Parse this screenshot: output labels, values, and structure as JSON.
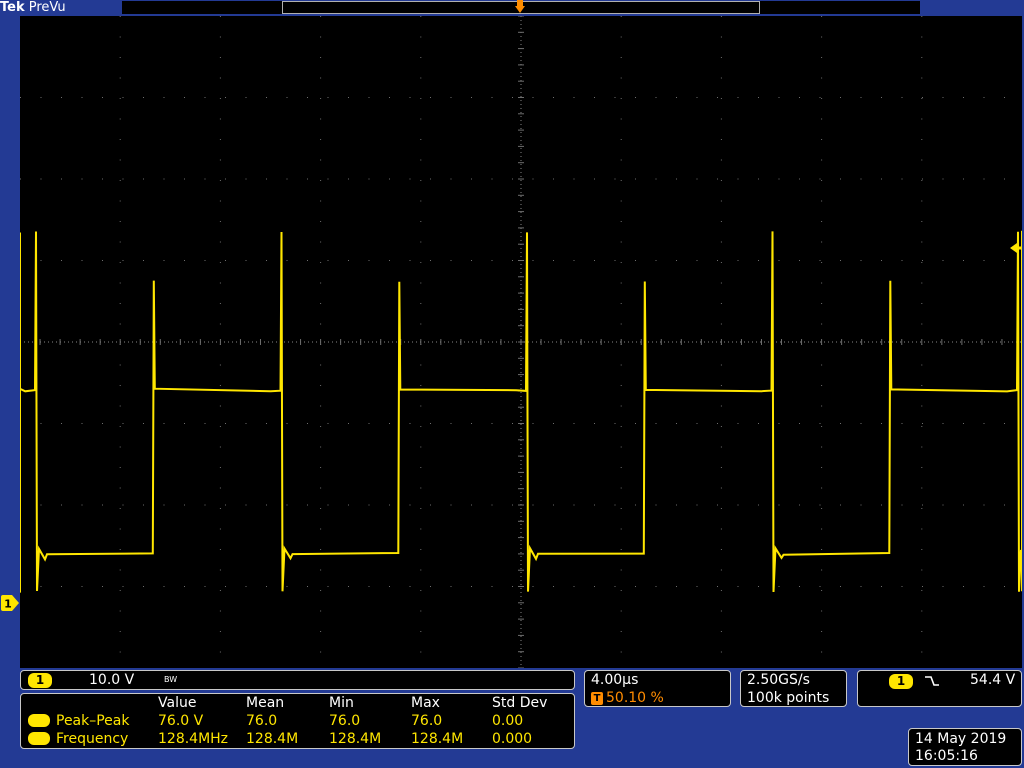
{
  "app": {
    "brand": "Tek",
    "mode": "PreVu"
  },
  "colors": {
    "background": "#233a94",
    "graticule_bg": "#000000",
    "trace": "#ffe600",
    "trigger": "#ff8c00",
    "text": "#ffffff"
  },
  "icons": {
    "trigger_position": "T",
    "channel_marker": "1",
    "slope": "falling-edge-icon",
    "bandwidth": "bw-limit-icon"
  },
  "channel": {
    "number": "1",
    "scale": "10.0 V",
    "bw_label": "BW"
  },
  "measurements": {
    "headers": [
      "Value",
      "Mean",
      "Min",
      "Max",
      "Std Dev"
    ],
    "rows": [
      {
        "ch": "1",
        "name": "Peak–Peak",
        "value": "76.0 V",
        "mean": "76.0",
        "min": "76.0",
        "max": "76.0",
        "std": "0.00"
      },
      {
        "ch": "1",
        "name": "Frequency",
        "value": "128.4MHz",
        "mean": "128.4M",
        "min": "128.4M",
        "max": "128.4M",
        "std": "0.000"
      }
    ]
  },
  "horizontal": {
    "scale": "4.00µs",
    "trigger_icon": "T",
    "trigger_position": "50.10 %"
  },
  "acquisition": {
    "sample_rate": "2.50GS/s",
    "record_length": "100k points"
  },
  "trigger": {
    "channel": "1",
    "slope_symbol": "⸝",
    "level": "54.4 V"
  },
  "timestamp": {
    "date": "14 May 2019",
    "time": "16:05:16"
  },
  "waveform": {
    "description_hidden": true,
    "period_divisions": 2.45,
    "low_level_divisions": -2.6,
    "high_level_divisions": -0.6,
    "spike_top_divisions": 1.6
  }
}
